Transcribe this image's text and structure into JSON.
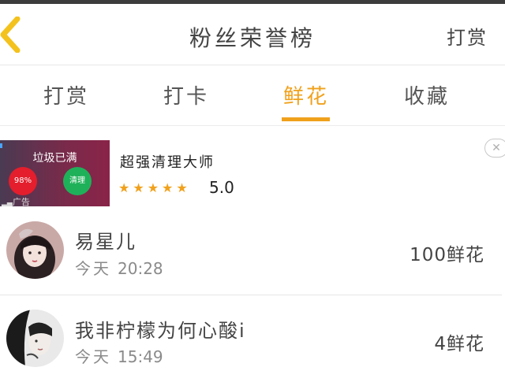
{
  "header": {
    "title": "粉丝荣誉榜",
    "action_label": "打赏"
  },
  "tabs": [
    {
      "label": "打赏",
      "active": false
    },
    {
      "label": "打卡",
      "active": false
    },
    {
      "label": "鲜花",
      "active": true
    },
    {
      "label": "收藏",
      "active": false
    }
  ],
  "accent_color": "#f0a11c",
  "ad": {
    "thumb_title": "垃圾已满",
    "thumb_percent": "98%",
    "thumb_clean": "清理",
    "thumb_ad_label": "广告",
    "name": "超强清理大师",
    "stars": 5,
    "rating": "5.0",
    "close_glyph": "✕"
  },
  "fans": [
    {
      "name": "易星儿",
      "day": "今天",
      "time": "20:28",
      "count": "100鲜花"
    },
    {
      "name": "我非柠檬为何心酸i",
      "day": "今天",
      "time": "15:49",
      "count": "4鲜花"
    }
  ]
}
